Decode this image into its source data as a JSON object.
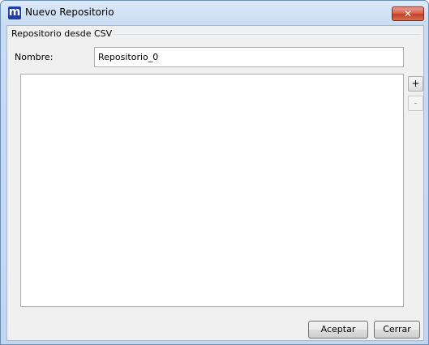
{
  "window": {
    "title": "Nuevo Repositorio",
    "app_icon_glyph": "m",
    "close_glyph": "✕"
  },
  "group": {
    "label": "Repositorio desde CSV"
  },
  "form": {
    "name_label": "Nombre:",
    "name_value": "Repositorio_0"
  },
  "list": {
    "add_label": "+",
    "remove_label": "-"
  },
  "buttons": {
    "accept_label": "Aceptar",
    "close_label": "Cerrar"
  },
  "colors": {
    "app_icon_bg": "#1f3fa6",
    "close_button_bg": "#c2402a",
    "frame": "#c2d6ef"
  },
  "icons": {
    "app": "m-logo-icon",
    "close": "close-icon"
  }
}
